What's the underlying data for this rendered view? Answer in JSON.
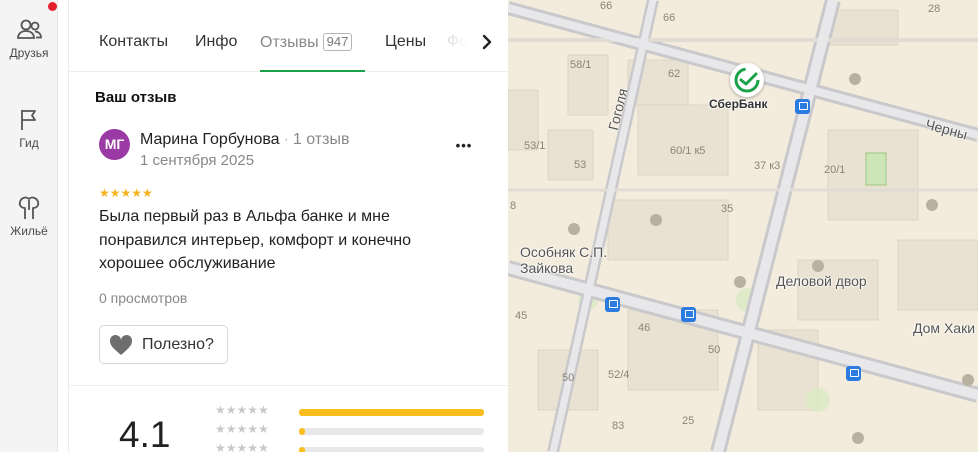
{
  "rail": {
    "friends_label": "Друзья",
    "guide_label": "Гид",
    "housing_label": "Жильё"
  },
  "tabs": {
    "contacts": "Контакты",
    "info": "Инфо",
    "reviews": "Отзывы",
    "reviews_count": "947",
    "prices": "Цены",
    "photos_partial": "Фо"
  },
  "review": {
    "section_title": "Ваш отзыв",
    "avatar_initials": "МГ",
    "author_name": "Марина Горбунова",
    "author_reviews": "1 отзыв",
    "separator": "·",
    "date": "1 сентября 2025",
    "stars": "★★★★★",
    "rating_value": 5,
    "text": "Была первый раз в Альфа банке и мне понравился интерьер, комфорт и конечно хорошее обслуживание",
    "views": "0 просмотров",
    "useful_label": "Полезно?",
    "more_label": "•••"
  },
  "rating_summary": {
    "overall": "4.1",
    "distribution": [
      {
        "stars": "★★★★★",
        "share": 1.0
      },
      {
        "stars": "★★★★★",
        "share": 0.03
      },
      {
        "stars": "★★★★★",
        "share": 0.03
      }
    ]
  },
  "map": {
    "house_numbers": [
      "66",
      "28",
      "58/1",
      "62",
      "53/1",
      "60/1 к5",
      "37 к3",
      "20/1",
      "53",
      "35",
      "45",
      "46",
      "50",
      "52/4",
      "50",
      "83",
      "25",
      "45"
    ],
    "streets": [
      "Гоголя",
      "Черны"
    ],
    "pois": [
      "СберБанк",
      "Особняк С.П. Зайкова",
      "Деловой двор",
      "Дом Хаки"
    ],
    "colors": {
      "background": "#f3ecdd",
      "road": "#c9c9cc",
      "block": "#e9e2d2",
      "park": "#cde6b8"
    }
  },
  "colors": {
    "accent_green": "#1aa24b",
    "star_gold": "#f6b220",
    "avatar_bg": "#9b3aa4",
    "notification": "#e5202e",
    "bar_fill": "#fbbd1c"
  }
}
